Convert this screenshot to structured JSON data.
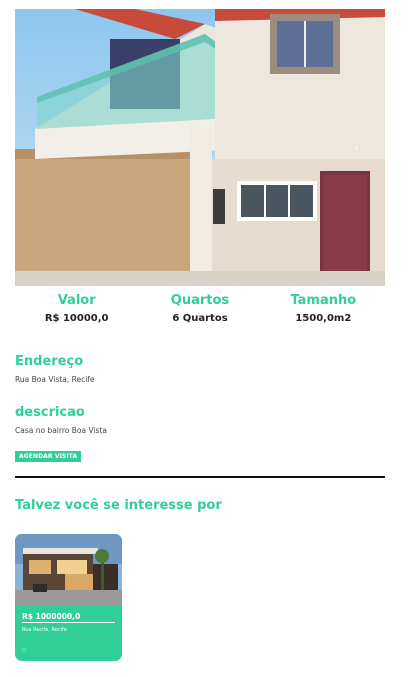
{
  "property": {
    "stats": [
      {
        "label": "Valor",
        "value": "R$ 10000,0"
      },
      {
        "label": "Quartos",
        "value": "6 Quartos"
      },
      {
        "label": "Tamanho",
        "value": "1500,0m2"
      }
    ],
    "address_title": "Endereço",
    "address": "Rua Boa Vista, Recife",
    "description_title": "descricao",
    "description": "Casa no bairro Boa Vista",
    "schedule_button": "AGENDAR VISITA"
  },
  "suggestions": {
    "title": "Talvez você se interesse por",
    "cards": [
      {
        "price": "R$ 1000000,0",
        "address": "Rua Recife, Recife",
        "dot": "○"
      }
    ]
  },
  "carousel": {
    "prev_icon": "‹",
    "next_icon": "›"
  },
  "colors": {
    "accent": "#2fcf97",
    "divider": "#111111"
  }
}
